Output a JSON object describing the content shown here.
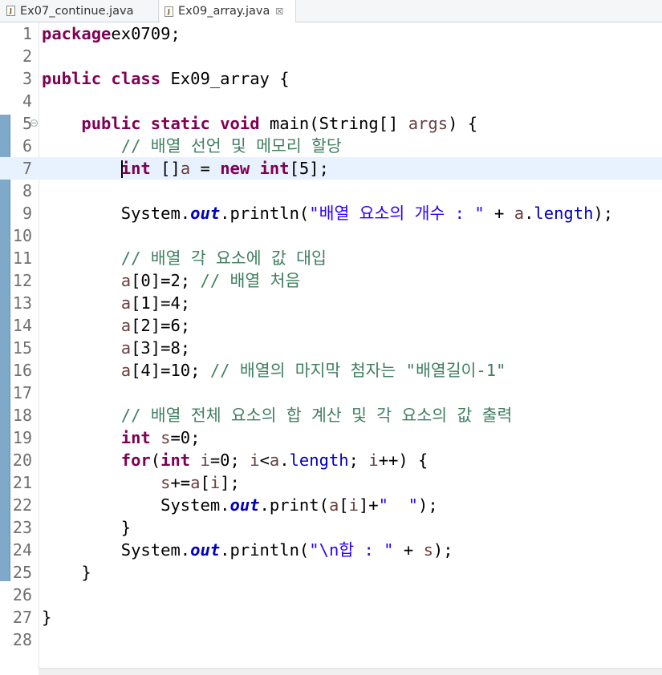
{
  "tabs": [
    {
      "label": "Ex07_continue.java",
      "active": false
    },
    {
      "label": "Ex09_array.java",
      "active": true
    }
  ],
  "tab_close_glyph": "☒",
  "icons": {
    "java-file": "J",
    "fold-collapse": "−"
  },
  "colors": {
    "keyword": "#7f0055",
    "string": "#2a00ff",
    "comment": "#3f7f5f",
    "field": "#0000c0",
    "local_variable": "#6a3e3e",
    "current_line": "#e8f2fe",
    "change_ruler": "#7fa9c9"
  },
  "editor": {
    "current_line": 7,
    "lines": [
      {
        "n": "1",
        "t": [
          [
            "kw",
            "package"
          ],
          [
            "",
            "ex0709;"
          ]
        ]
      },
      {
        "n": "2",
        "t": []
      },
      {
        "n": "3",
        "t": [
          [
            "kw",
            "public"
          ],
          [
            "",
            " "
          ],
          [
            "kw",
            "class"
          ],
          [
            "",
            " Ex09_array {"
          ]
        ]
      },
      {
        "n": "4",
        "t": []
      },
      {
        "n": "5",
        "t": [
          [
            "",
            "    "
          ],
          [
            "kw",
            "public"
          ],
          [
            "",
            " "
          ],
          [
            "kw",
            "static"
          ],
          [
            "",
            " "
          ],
          [
            "kw",
            "void"
          ],
          [
            "",
            " main(String[] "
          ],
          [
            "var",
            "args"
          ],
          [
            "",
            ") {"
          ]
        ]
      },
      {
        "n": "6",
        "t": [
          [
            "",
            "        "
          ],
          [
            "com",
            "// 배열 선언 및 메모리 할당"
          ]
        ]
      },
      {
        "n": "7",
        "t": [
          [
            "",
            "        "
          ],
          [
            "caret",
            ""
          ],
          [
            "kw",
            "int"
          ],
          [
            "",
            " []"
          ],
          [
            "var",
            "a"
          ],
          [
            "",
            " = "
          ],
          [
            "kw",
            "new"
          ],
          [
            "",
            " "
          ],
          [
            "kw",
            "int"
          ],
          [
            "",
            "[5];"
          ]
        ]
      },
      {
        "n": "8",
        "t": []
      },
      {
        "n": "9",
        "t": [
          [
            "",
            "        System."
          ],
          [
            "sfld",
            "out"
          ],
          [
            "",
            ".println("
          ],
          [
            "str",
            "\"배열 요소의 개수 : \""
          ],
          [
            "",
            " + "
          ],
          [
            "var",
            "a"
          ],
          [
            "",
            "."
          ],
          [
            "fld",
            "length"
          ],
          [
            "",
            ");"
          ]
        ]
      },
      {
        "n": "10",
        "t": []
      },
      {
        "n": "11",
        "t": [
          [
            "",
            "        "
          ],
          [
            "com",
            "// 배열 각 요소에 값 대입"
          ]
        ]
      },
      {
        "n": "12",
        "t": [
          [
            "",
            "        "
          ],
          [
            "var",
            "a"
          ],
          [
            "",
            "[0]=2; "
          ],
          [
            "com",
            "// 배열 처음"
          ]
        ]
      },
      {
        "n": "13",
        "t": [
          [
            "",
            "        "
          ],
          [
            "var",
            "a"
          ],
          [
            "",
            "[1]=4;"
          ]
        ]
      },
      {
        "n": "14",
        "t": [
          [
            "",
            "        "
          ],
          [
            "var",
            "a"
          ],
          [
            "",
            "[2]=6;"
          ]
        ]
      },
      {
        "n": "15",
        "t": [
          [
            "",
            "        "
          ],
          [
            "var",
            "a"
          ],
          [
            "",
            "[3]=8;"
          ]
        ]
      },
      {
        "n": "16",
        "t": [
          [
            "",
            "        "
          ],
          [
            "var",
            "a"
          ],
          [
            "",
            "[4]=10; "
          ],
          [
            "com",
            "// 배열의 마지막 첨자는 \"배열길이-1\""
          ]
        ]
      },
      {
        "n": "17",
        "t": []
      },
      {
        "n": "18",
        "t": [
          [
            "",
            "        "
          ],
          [
            "com",
            "// 배열 전체 요소의 합 계산 및 각 요소의 값 출력"
          ]
        ]
      },
      {
        "n": "19",
        "t": [
          [
            "",
            "        "
          ],
          [
            "kw",
            "int"
          ],
          [
            "",
            " "
          ],
          [
            "var",
            "s"
          ],
          [
            "",
            "=0;"
          ]
        ]
      },
      {
        "n": "20",
        "t": [
          [
            "",
            "        "
          ],
          [
            "kw",
            "for"
          ],
          [
            "",
            "("
          ],
          [
            "kw",
            "int"
          ],
          [
            "",
            " "
          ],
          [
            "var",
            "i"
          ],
          [
            "",
            "=0; "
          ],
          [
            "var",
            "i"
          ],
          [
            "",
            "<"
          ],
          [
            "var",
            "a"
          ],
          [
            "",
            "."
          ],
          [
            "fld",
            "length"
          ],
          [
            "",
            "; "
          ],
          [
            "var",
            "i"
          ],
          [
            "",
            "++) {"
          ]
        ]
      },
      {
        "n": "21",
        "t": [
          [
            "",
            "            "
          ],
          [
            "var",
            "s"
          ],
          [
            "",
            "+="
          ],
          [
            "var",
            "a"
          ],
          [
            "",
            "["
          ],
          [
            "var",
            "i"
          ],
          [
            "",
            "];"
          ]
        ]
      },
      {
        "n": "22",
        "t": [
          [
            "",
            "            System."
          ],
          [
            "sfld",
            "out"
          ],
          [
            "",
            ".print("
          ],
          [
            "var",
            "a"
          ],
          [
            "",
            "["
          ],
          [
            "var",
            "i"
          ],
          [
            "",
            "]+"
          ],
          [
            "str",
            "\"  \""
          ],
          [
            "",
            ");"
          ]
        ]
      },
      {
        "n": "23",
        "t": [
          [
            "",
            "        }"
          ]
        ]
      },
      {
        "n": "24",
        "t": [
          [
            "",
            "        System."
          ],
          [
            "sfld",
            "out"
          ],
          [
            "",
            ".println("
          ],
          [
            "str",
            "\"\\n합 : \""
          ],
          [
            "",
            " + "
          ],
          [
            "var",
            "s"
          ],
          [
            "",
            ");"
          ]
        ]
      },
      {
        "n": "25",
        "t": [
          [
            "",
            "    }"
          ]
        ]
      },
      {
        "n": "26",
        "t": []
      },
      {
        "n": "27",
        "t": [
          [
            "",
            "}"
          ]
        ]
      },
      {
        "n": "28",
        "t": []
      }
    ]
  }
}
